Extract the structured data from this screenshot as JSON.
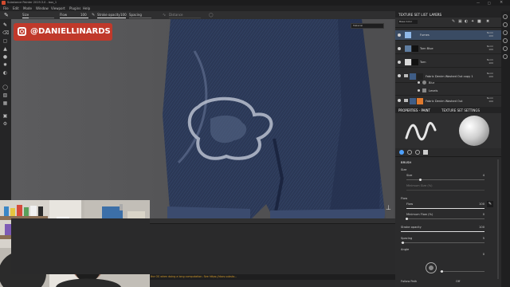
{
  "window": {
    "title": "Substance Painter 2019.3.0 - box_1"
  },
  "menu": [
    "File",
    "Edit",
    "Mode",
    "Window",
    "Viewport",
    "Plugins",
    "Help"
  ],
  "toolbar": {
    "size_label": "Size",
    "flow_label": "Flow",
    "flow_value": "100",
    "stroke_opacity_label": "Stroke opacity",
    "stroke_opacity_value": "100",
    "spacing_label": "Spacing",
    "distance_label": "Distance"
  },
  "overlay": {
    "handle": "@DANIELLINARDS"
  },
  "viewport": {
    "mode_select": "Material"
  },
  "texture_set_list_tab": "TEXTURE SET LIST",
  "layers_tab": "LAYERS",
  "channel_select": "Base Color",
  "layers": [
    {
      "name": "Fumes",
      "blend": "Norm",
      "opacity": "100",
      "thumb": "#8eb7e8"
    },
    {
      "name": "Torn Blue",
      "blend": "Norm",
      "opacity": "100",
      "thumb": "#111111"
    },
    {
      "name": "Torn",
      "blend": "Norm",
      "opacity": "100",
      "thumb": "#d9d9d9"
    },
    {
      "name": "Fabric Denim Washed Out copy 1",
      "blend": "Norm",
      "opacity": "100",
      "thumb": "#3f5d86"
    },
    {
      "name": "Blur",
      "blend": "",
      "opacity": "",
      "thumb": "#777777"
    },
    {
      "name": "Levels",
      "blend": "",
      "opacity": "",
      "thumb": "#777777"
    },
    {
      "name": "Fabric Denim Washed Out",
      "blend": "Norm",
      "opacity": "100",
      "thumb": "#3f5d86"
    }
  ],
  "properties_tab": "PROPERTIES - PAINT",
  "texture_set_settings_tab": "TEXTURE SET SETTINGS",
  "brush": {
    "section_title": "BRUSH",
    "size_label": "Size",
    "size_name": "Size",
    "size_value": "4",
    "minimum_size_label": "Minimum Size (%)",
    "flow_section": "Flow",
    "flow_name": "Flow",
    "flow_value": "100",
    "minimum_flow_label": "Minimum Flow (%)",
    "minimum_flow_value": "0",
    "stroke_opacity_label": "Stroke opacity",
    "stroke_opacity_value": "100",
    "spacing_label": "Spacing",
    "spacing_value": "5",
    "angle_label": "Angle",
    "angle_value": "0",
    "follow_path_label": "Follow Path",
    "follow_path_value": "Off"
  },
  "statusbar": {
    "message": "the OS when doing a long computation. See https://docs.substa...",
    "cache": "Cache Disk Usage: 47%"
  },
  "colors": {
    "accent": "#c0392b",
    "denim": "#2e3b59"
  }
}
